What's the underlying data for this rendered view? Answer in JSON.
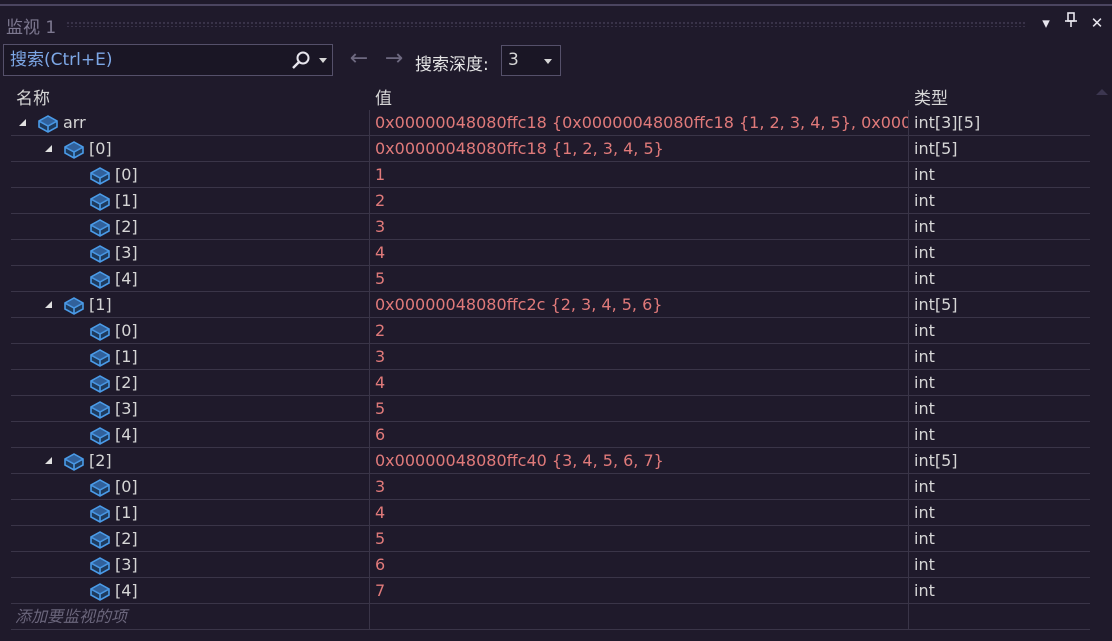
{
  "window": {
    "title": "监视 1"
  },
  "toolbar": {
    "search_placeholder": "搜索(Ctrl+E)",
    "search_value": "",
    "back_arrow": "←",
    "forward_arrow": "→",
    "depth_label": "搜索深度:",
    "depth_value": "3"
  },
  "columns": {
    "name": "名称",
    "value": "值",
    "type": "类型"
  },
  "rows": [
    {
      "level": 0,
      "expandable": true,
      "name": "arr",
      "value": "0x00000048080ffc18 {0x00000048080ffc18 {1, 2, 3, 4, 5}, 0x0000...",
      "type": "int[3][5]"
    },
    {
      "level": 1,
      "expandable": true,
      "name": "[0]",
      "value": "0x00000048080ffc18 {1, 2, 3, 4, 5}",
      "type": "int[5]"
    },
    {
      "level": 2,
      "expandable": false,
      "name": "[0]",
      "value": "1",
      "type": "int"
    },
    {
      "level": 2,
      "expandable": false,
      "name": "[1]",
      "value": "2",
      "type": "int"
    },
    {
      "level": 2,
      "expandable": false,
      "name": "[2]",
      "value": "3",
      "type": "int"
    },
    {
      "level": 2,
      "expandable": false,
      "name": "[3]",
      "value": "4",
      "type": "int"
    },
    {
      "level": 2,
      "expandable": false,
      "name": "[4]",
      "value": "5",
      "type": "int"
    },
    {
      "level": 1,
      "expandable": true,
      "name": "[1]",
      "value": "0x00000048080ffc2c {2, 3, 4, 5, 6}",
      "type": "int[5]"
    },
    {
      "level": 2,
      "expandable": false,
      "name": "[0]",
      "value": "2",
      "type": "int"
    },
    {
      "level": 2,
      "expandable": false,
      "name": "[1]",
      "value": "3",
      "type": "int"
    },
    {
      "level": 2,
      "expandable": false,
      "name": "[2]",
      "value": "4",
      "type": "int"
    },
    {
      "level": 2,
      "expandable": false,
      "name": "[3]",
      "value": "5",
      "type": "int"
    },
    {
      "level": 2,
      "expandable": false,
      "name": "[4]",
      "value": "6",
      "type": "int"
    },
    {
      "level": 1,
      "expandable": true,
      "name": "[2]",
      "value": "0x00000048080ffc40 {3, 4, 5, 6, 7}",
      "type": "int[5]"
    },
    {
      "level": 2,
      "expandable": false,
      "name": "[0]",
      "value": "3",
      "type": "int"
    },
    {
      "level": 2,
      "expandable": false,
      "name": "[1]",
      "value": "4",
      "type": "int"
    },
    {
      "level": 2,
      "expandable": false,
      "name": "[2]",
      "value": "5",
      "type": "int"
    },
    {
      "level": 2,
      "expandable": false,
      "name": "[3]",
      "value": "6",
      "type": "int"
    },
    {
      "level": 2,
      "expandable": false,
      "name": "[4]",
      "value": "7",
      "type": "int"
    }
  ],
  "add_item_placeholder": "添加要监视的项",
  "colors": {
    "background": "#1f1a2b",
    "value_text": "#e07a7a",
    "search_text": "#7da7e6",
    "grid_line": "#3a3548",
    "icon_blue": "#4a9be8"
  }
}
